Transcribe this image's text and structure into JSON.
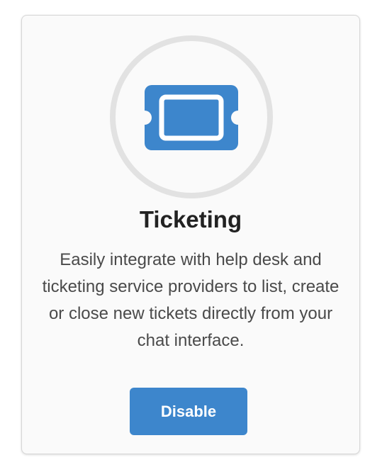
{
  "integration": {
    "icon": "ticket-icon",
    "title": "Ticketing",
    "description": "Easily integrate with help desk and ticketing service providers to list, create or close new tickets directly from your chat interface.",
    "button_label": "Disable"
  },
  "colors": {
    "accent": "#3d86cc",
    "ring": "#e2e2e2",
    "title_text": "#222222",
    "body_text": "#4a4a4a",
    "card_background": "#fafafa"
  }
}
